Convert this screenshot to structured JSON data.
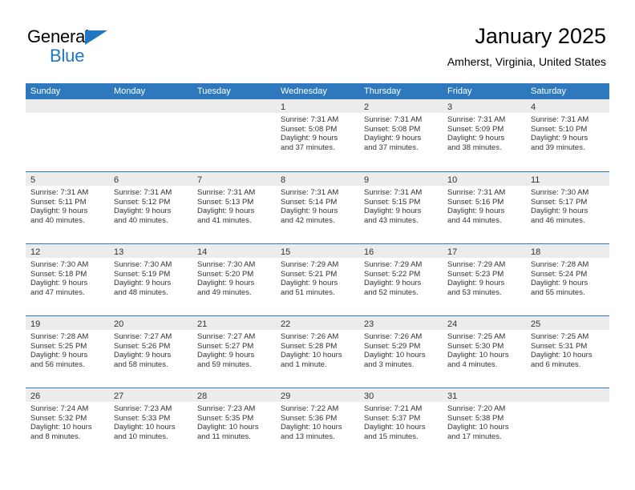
{
  "brand": {
    "name_part1": "General",
    "name_part2": "Blue",
    "color_primary": "#1f78c1"
  },
  "header": {
    "title": "January 2025",
    "subtitle": "Amherst, Virginia, United States"
  },
  "calendar": {
    "header_bg": "#2e79bd",
    "day_band_bg": "#ececec",
    "weekdays": [
      "Sunday",
      "Monday",
      "Tuesday",
      "Wednesday",
      "Thursday",
      "Friday",
      "Saturday"
    ],
    "weeks": [
      [
        {
          "day": "",
          "empty": true,
          "l1": "",
          "l2": "",
          "l3": "",
          "l4": ""
        },
        {
          "day": "",
          "empty": true,
          "l1": "",
          "l2": "",
          "l3": "",
          "l4": ""
        },
        {
          "day": "",
          "empty": true,
          "l1": "",
          "l2": "",
          "l3": "",
          "l4": ""
        },
        {
          "day": "1",
          "empty": false,
          "l1": "Sunrise: 7:31 AM",
          "l2": "Sunset: 5:08 PM",
          "l3": "Daylight: 9 hours",
          "l4": "and 37 minutes."
        },
        {
          "day": "2",
          "empty": false,
          "l1": "Sunrise: 7:31 AM",
          "l2": "Sunset: 5:08 PM",
          "l3": "Daylight: 9 hours",
          "l4": "and 37 minutes."
        },
        {
          "day": "3",
          "empty": false,
          "l1": "Sunrise: 7:31 AM",
          "l2": "Sunset: 5:09 PM",
          "l3": "Daylight: 9 hours",
          "l4": "and 38 minutes."
        },
        {
          "day": "4",
          "empty": false,
          "l1": "Sunrise: 7:31 AM",
          "l2": "Sunset: 5:10 PM",
          "l3": "Daylight: 9 hours",
          "l4": "and 39 minutes."
        }
      ],
      [
        {
          "day": "5",
          "empty": false,
          "l1": "Sunrise: 7:31 AM",
          "l2": "Sunset: 5:11 PM",
          "l3": "Daylight: 9 hours",
          "l4": "and 40 minutes."
        },
        {
          "day": "6",
          "empty": false,
          "l1": "Sunrise: 7:31 AM",
          "l2": "Sunset: 5:12 PM",
          "l3": "Daylight: 9 hours",
          "l4": "and 40 minutes."
        },
        {
          "day": "7",
          "empty": false,
          "l1": "Sunrise: 7:31 AM",
          "l2": "Sunset: 5:13 PM",
          "l3": "Daylight: 9 hours",
          "l4": "and 41 minutes."
        },
        {
          "day": "8",
          "empty": false,
          "l1": "Sunrise: 7:31 AM",
          "l2": "Sunset: 5:14 PM",
          "l3": "Daylight: 9 hours",
          "l4": "and 42 minutes."
        },
        {
          "day": "9",
          "empty": false,
          "l1": "Sunrise: 7:31 AM",
          "l2": "Sunset: 5:15 PM",
          "l3": "Daylight: 9 hours",
          "l4": "and 43 minutes."
        },
        {
          "day": "10",
          "empty": false,
          "l1": "Sunrise: 7:31 AM",
          "l2": "Sunset: 5:16 PM",
          "l3": "Daylight: 9 hours",
          "l4": "and 44 minutes."
        },
        {
          "day": "11",
          "empty": false,
          "l1": "Sunrise: 7:30 AM",
          "l2": "Sunset: 5:17 PM",
          "l3": "Daylight: 9 hours",
          "l4": "and 46 minutes."
        }
      ],
      [
        {
          "day": "12",
          "empty": false,
          "l1": "Sunrise: 7:30 AM",
          "l2": "Sunset: 5:18 PM",
          "l3": "Daylight: 9 hours",
          "l4": "and 47 minutes."
        },
        {
          "day": "13",
          "empty": false,
          "l1": "Sunrise: 7:30 AM",
          "l2": "Sunset: 5:19 PM",
          "l3": "Daylight: 9 hours",
          "l4": "and 48 minutes."
        },
        {
          "day": "14",
          "empty": false,
          "l1": "Sunrise: 7:30 AM",
          "l2": "Sunset: 5:20 PM",
          "l3": "Daylight: 9 hours",
          "l4": "and 49 minutes."
        },
        {
          "day": "15",
          "empty": false,
          "l1": "Sunrise: 7:29 AM",
          "l2": "Sunset: 5:21 PM",
          "l3": "Daylight: 9 hours",
          "l4": "and 51 minutes."
        },
        {
          "day": "16",
          "empty": false,
          "l1": "Sunrise: 7:29 AM",
          "l2": "Sunset: 5:22 PM",
          "l3": "Daylight: 9 hours",
          "l4": "and 52 minutes."
        },
        {
          "day": "17",
          "empty": false,
          "l1": "Sunrise: 7:29 AM",
          "l2": "Sunset: 5:23 PM",
          "l3": "Daylight: 9 hours",
          "l4": "and 53 minutes."
        },
        {
          "day": "18",
          "empty": false,
          "l1": "Sunrise: 7:28 AM",
          "l2": "Sunset: 5:24 PM",
          "l3": "Daylight: 9 hours",
          "l4": "and 55 minutes."
        }
      ],
      [
        {
          "day": "19",
          "empty": false,
          "l1": "Sunrise: 7:28 AM",
          "l2": "Sunset: 5:25 PM",
          "l3": "Daylight: 9 hours",
          "l4": "and 56 minutes."
        },
        {
          "day": "20",
          "empty": false,
          "l1": "Sunrise: 7:27 AM",
          "l2": "Sunset: 5:26 PM",
          "l3": "Daylight: 9 hours",
          "l4": "and 58 minutes."
        },
        {
          "day": "21",
          "empty": false,
          "l1": "Sunrise: 7:27 AM",
          "l2": "Sunset: 5:27 PM",
          "l3": "Daylight: 9 hours",
          "l4": "and 59 minutes."
        },
        {
          "day": "22",
          "empty": false,
          "l1": "Sunrise: 7:26 AM",
          "l2": "Sunset: 5:28 PM",
          "l3": "Daylight: 10 hours",
          "l4": "and 1 minute."
        },
        {
          "day": "23",
          "empty": false,
          "l1": "Sunrise: 7:26 AM",
          "l2": "Sunset: 5:29 PM",
          "l3": "Daylight: 10 hours",
          "l4": "and 3 minutes."
        },
        {
          "day": "24",
          "empty": false,
          "l1": "Sunrise: 7:25 AM",
          "l2": "Sunset: 5:30 PM",
          "l3": "Daylight: 10 hours",
          "l4": "and 4 minutes."
        },
        {
          "day": "25",
          "empty": false,
          "l1": "Sunrise: 7:25 AM",
          "l2": "Sunset: 5:31 PM",
          "l3": "Daylight: 10 hours",
          "l4": "and 6 minutes."
        }
      ],
      [
        {
          "day": "26",
          "empty": false,
          "l1": "Sunrise: 7:24 AM",
          "l2": "Sunset: 5:32 PM",
          "l3": "Daylight: 10 hours",
          "l4": "and 8 minutes."
        },
        {
          "day": "27",
          "empty": false,
          "l1": "Sunrise: 7:23 AM",
          "l2": "Sunset: 5:33 PM",
          "l3": "Daylight: 10 hours",
          "l4": "and 10 minutes."
        },
        {
          "day": "28",
          "empty": false,
          "l1": "Sunrise: 7:23 AM",
          "l2": "Sunset: 5:35 PM",
          "l3": "Daylight: 10 hours",
          "l4": "and 11 minutes."
        },
        {
          "day": "29",
          "empty": false,
          "l1": "Sunrise: 7:22 AM",
          "l2": "Sunset: 5:36 PM",
          "l3": "Daylight: 10 hours",
          "l4": "and 13 minutes."
        },
        {
          "day": "30",
          "empty": false,
          "l1": "Sunrise: 7:21 AM",
          "l2": "Sunset: 5:37 PM",
          "l3": "Daylight: 10 hours",
          "l4": "and 15 minutes."
        },
        {
          "day": "31",
          "empty": false,
          "l1": "Sunrise: 7:20 AM",
          "l2": "Sunset: 5:38 PM",
          "l3": "Daylight: 10 hours",
          "l4": "and 17 minutes."
        },
        {
          "day": "",
          "empty": true,
          "l1": "",
          "l2": "",
          "l3": "",
          "l4": ""
        }
      ]
    ]
  }
}
